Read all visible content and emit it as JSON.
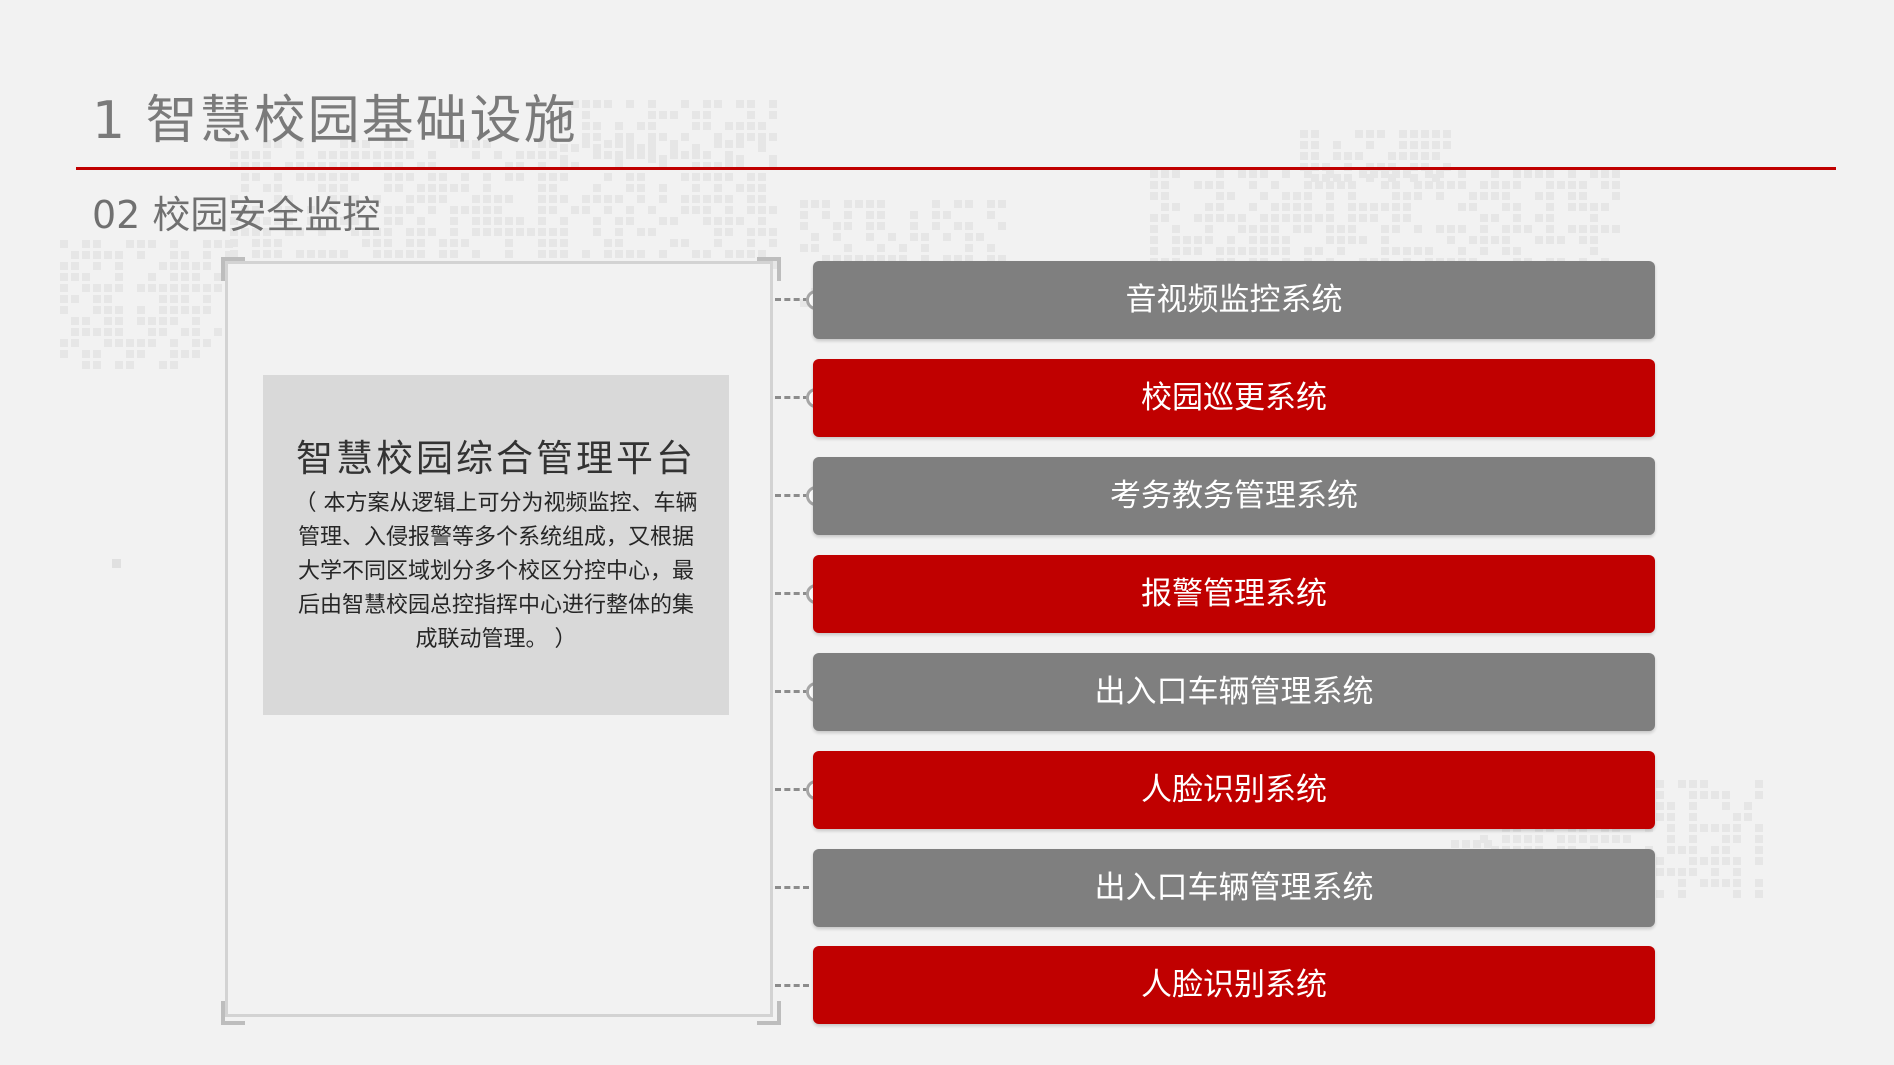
{
  "slide": {
    "title": "1 智慧校园基础设施",
    "subtitle": "02 校园安全监控"
  },
  "platform": {
    "title": "智慧校园综合管理平台",
    "description": "（ 本方案从逻辑上可分为视频监控、车辆管理、入侵报警等多个系统组成，又根据大学不同区域划分多个校区分控中心，最后由智慧校园总控指挥中心进行整体的集成联动管理。 ）"
  },
  "systems": [
    {
      "label": "音视频监控系统",
      "color": "gray"
    },
    {
      "label": "校园巡更系统",
      "color": "red"
    },
    {
      "label": "考务教务管理系统",
      "color": "gray"
    },
    {
      "label": "报警管理系统",
      "color": "red"
    },
    {
      "label": "出入口车辆管理系统",
      "color": "gray"
    },
    {
      "label": "人脸识别系统",
      "color": "red"
    },
    {
      "label": "出入口车辆管理系统",
      "color": "gray"
    },
    {
      "label": "人脸识别系统",
      "color": "red"
    }
  ],
  "colors": {
    "accent_red": "#c00000",
    "bar_gray": "#7f7f7f",
    "background": "#f2f2f2"
  }
}
